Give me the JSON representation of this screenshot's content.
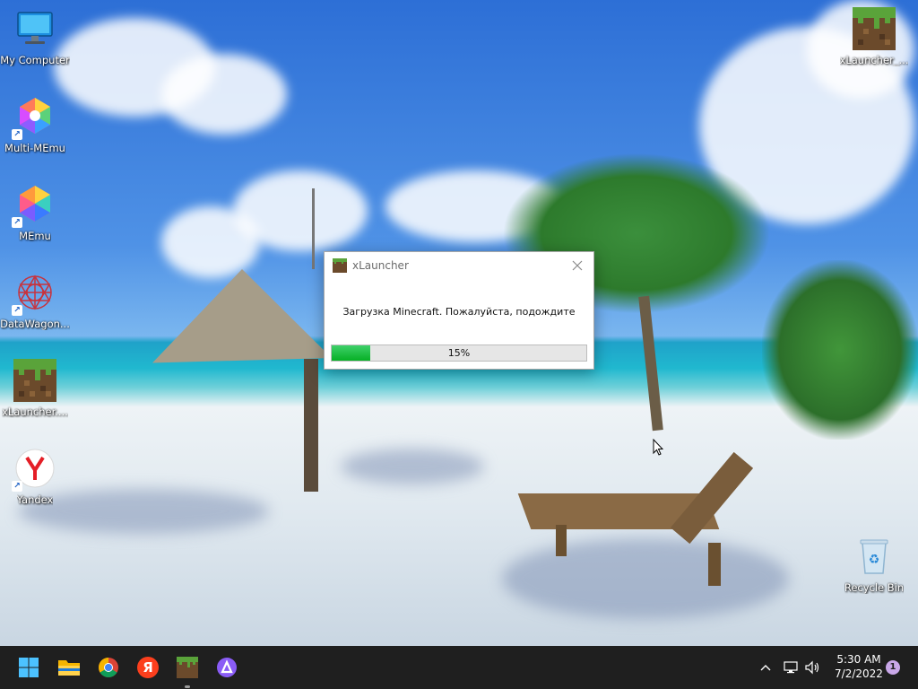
{
  "desktop": {
    "icons_left": [
      {
        "label": "My Computer",
        "icon": "monitor-icon"
      },
      {
        "label": "Multi-MEmu",
        "icon": "memu-icon"
      },
      {
        "label": "MEmu",
        "icon": "memu-icon"
      },
      {
        "label": "DataWagon...",
        "icon": "datawagon-icon"
      },
      {
        "label": "xLauncher....",
        "icon": "minecraft-grass-icon"
      },
      {
        "label": "Yandex",
        "icon": "yandex-icon"
      }
    ],
    "icons_right": [
      {
        "label": "xLauncher_...",
        "icon": "minecraft-grass-icon"
      },
      {
        "label": "Recycle Bin",
        "icon": "recycle-bin-icon"
      }
    ]
  },
  "dialog": {
    "title": "xLauncher",
    "message": "Загрузка Minecraft. Пожалуйста, подождите",
    "progress_percent": 15,
    "progress_label": "15%",
    "fill_color": "#06b025"
  },
  "taskbar": {
    "pinned": [
      {
        "icon": "windows-start-icon"
      },
      {
        "icon": "file-explorer-icon"
      },
      {
        "icon": "chrome-icon"
      },
      {
        "icon": "yandex-browser-icon",
        "glyph": "Я"
      },
      {
        "icon": "minecraft-grass-icon",
        "active": true
      },
      {
        "icon": "alice-icon"
      }
    ],
    "tray": {
      "chevron": "chevron-up-icon",
      "network": "network-icon",
      "volume": "volume-icon"
    },
    "clock": {
      "time": "5:30 AM",
      "date": "7/2/2022"
    },
    "notification_count": "1"
  }
}
